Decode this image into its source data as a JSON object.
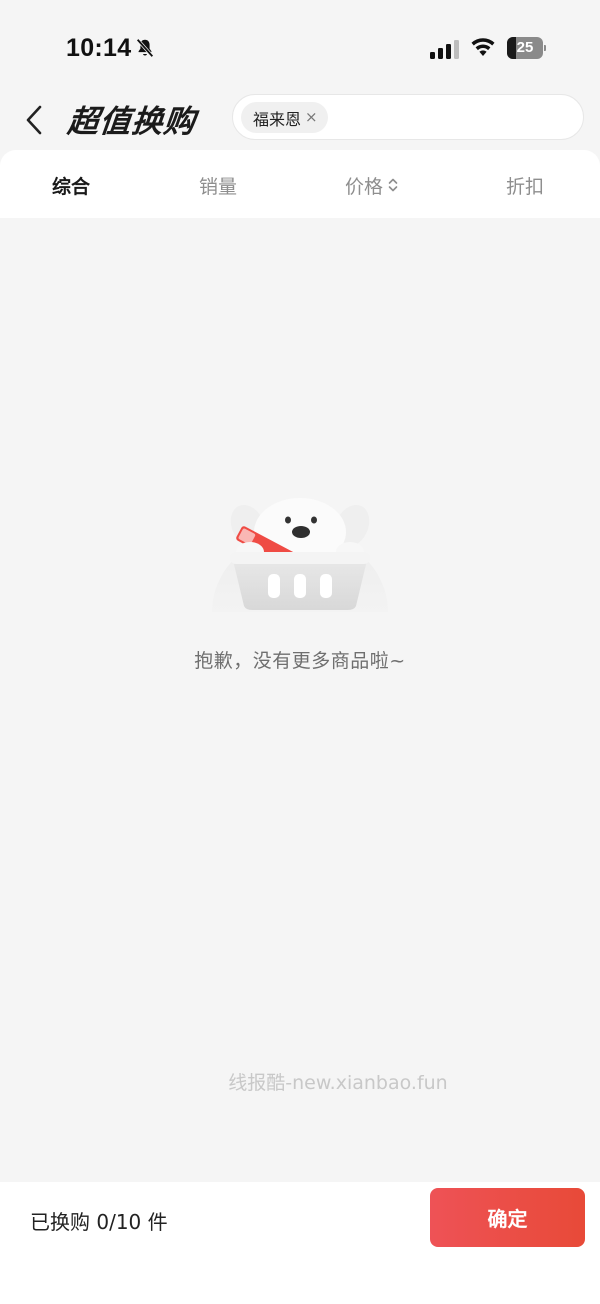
{
  "status_bar": {
    "time": "10:14",
    "battery": "25",
    "battery_level": 0.25
  },
  "header": {
    "title": "超值换购",
    "search_chip": "福来恩",
    "chip_close": "×"
  },
  "tabs": [
    {
      "label": "综合",
      "active": true
    },
    {
      "label": "销量",
      "active": false
    },
    {
      "label": "价格",
      "active": false
    },
    {
      "label": "折扣",
      "active": false
    }
  ],
  "empty_state": {
    "message": "抱歉，没有更多商品啦~"
  },
  "watermark": "线报酷-new.xianbao.fun",
  "footer": {
    "purchased": "已换购 0/10 件",
    "confirm_label": "确定"
  },
  "colors": {
    "accent": "#e84c3d",
    "background": "#f5f5f5"
  }
}
